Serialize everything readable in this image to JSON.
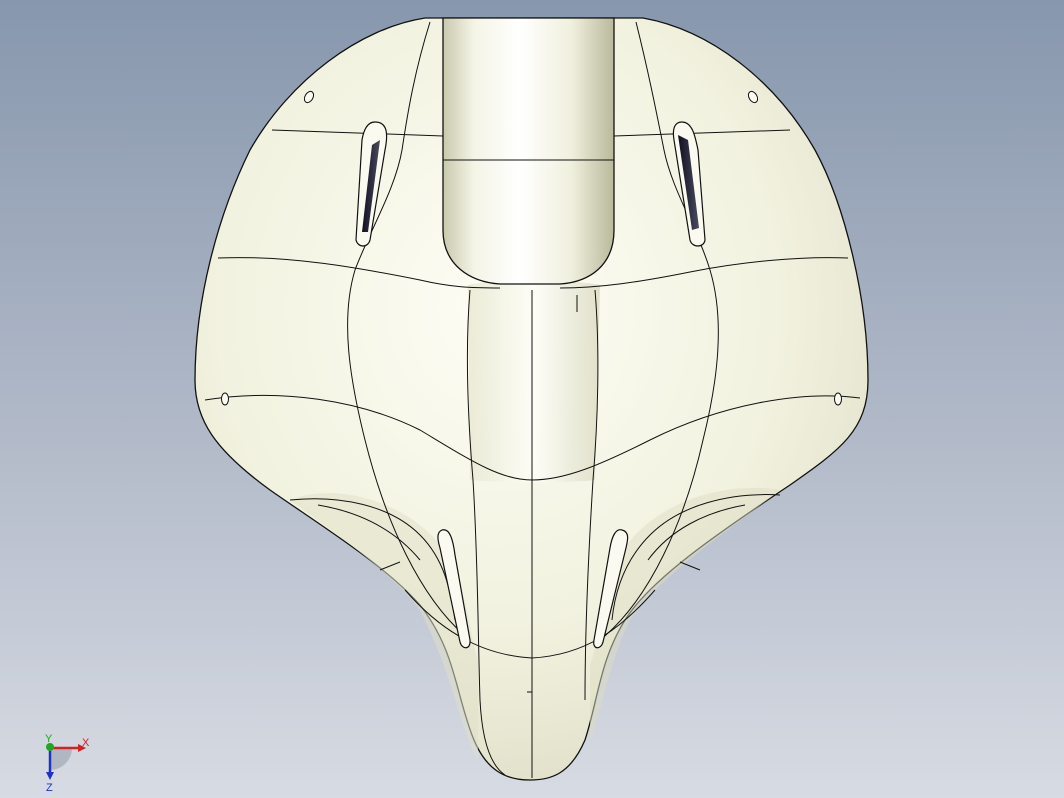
{
  "viewport": {
    "background_top": "#8797ad",
    "background_bottom": "#d7dbe3",
    "model_color": "#f4f4e4",
    "edge_color": "#111111"
  },
  "triad": {
    "x_label": "X",
    "y_label": "Y",
    "z_label": "Z",
    "x_color": "#d42020",
    "y_color": "#1fa81f",
    "z_color": "#2030c8"
  }
}
